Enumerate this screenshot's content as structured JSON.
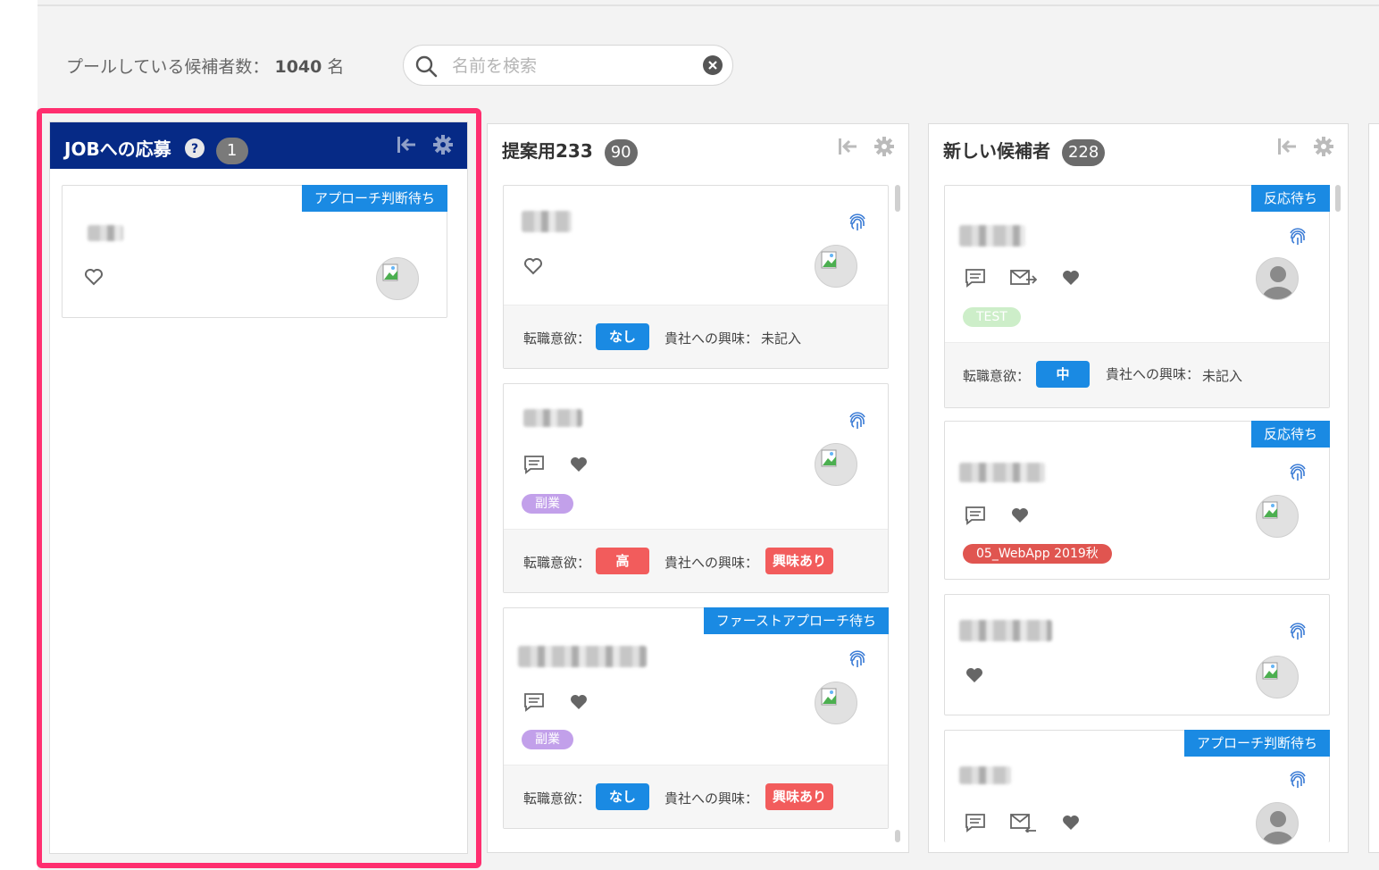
{
  "pool": {
    "label": "プールしている候補者数：",
    "count": "1040",
    "unit": "名"
  },
  "search": {
    "placeholder": "名前を検索"
  },
  "columns": [
    {
      "title": "JOBへの応募",
      "count": "1",
      "cards": [
        {
          "status": "アプローチ判断待ち"
        }
      ]
    },
    {
      "title": "提案用233",
      "count": "90",
      "cards": [
        {
          "desire_label": "転職意欲：",
          "desire": "なし",
          "interest_label": "貴社への興味：",
          "interest": "未記入"
        },
        {
          "tag": "副業",
          "desire_label": "転職意欲：",
          "desire": "高",
          "interest_label": "貴社への興味：",
          "interest": "興味あり"
        },
        {
          "status": "ファーストアプローチ待ち",
          "tag": "副業",
          "desire_label": "転職意欲：",
          "desire": "なし",
          "interest_label": "貴社への興味：",
          "interest": "興味あり"
        }
      ]
    },
    {
      "title": "新しい候補者",
      "count": "228",
      "cards": [
        {
          "status": "反応待ち",
          "tag": "TEST",
          "desire_label": "転職意欲：",
          "desire": "中",
          "interest_label": "貴社への興味：",
          "interest": "未記入"
        },
        {
          "status": "反応待ち",
          "tag": "05_WebApp 2019秋"
        },
        {},
        {
          "status": "アプローチ判断待ち"
        }
      ]
    }
  ],
  "colors": {
    "highlight": "#ff2e6f",
    "header_blue": "#062a86",
    "status_blue": "#1a8ae3",
    "chip_red": "#f25c5c"
  }
}
